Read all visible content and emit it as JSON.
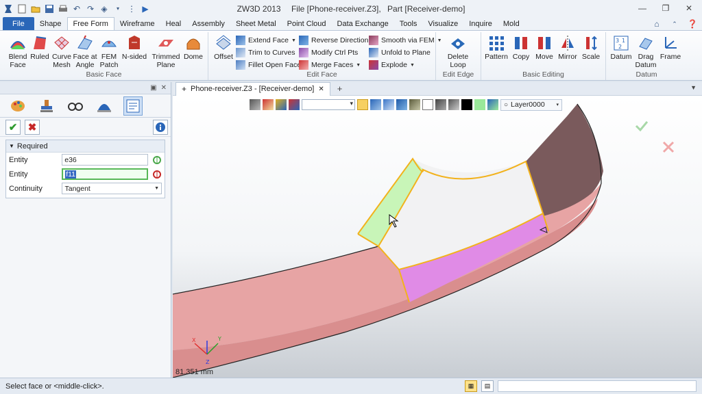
{
  "window": {
    "app_title": "ZW3D 2013",
    "file_title": "File [Phone-receiver.Z3],",
    "part_title": "Part [Receiver-demo]"
  },
  "tabs": [
    "File",
    "Shape",
    "Free Form",
    "Wireframe",
    "Heal",
    "Assembly",
    "Sheet Metal",
    "Point Cloud",
    "Data Exchange",
    "Tools",
    "Visualize",
    "Inquire",
    "Mold"
  ],
  "active_tab": "Free Form",
  "ribbon": {
    "basic_face": {
      "label": "Basic Face",
      "buttons": [
        {
          "l1": "Blend",
          "l2": "Face"
        },
        {
          "l1": "Ruled",
          "l2": ""
        },
        {
          "l1": "Curve",
          "l2": "Mesh"
        },
        {
          "l1": "Face at",
          "l2": "Angle"
        },
        {
          "l1": "FEM",
          "l2": "Patch"
        },
        {
          "l1": "N-sided",
          "l2": ""
        },
        {
          "l1": "Trimmed",
          "l2": "Plane"
        },
        {
          "l1": "Dome",
          "l2": ""
        }
      ]
    },
    "edit_face": {
      "label": "Edit Face",
      "offset": "Offset",
      "col1": [
        "Extend Face",
        "Trim to Curves",
        "Fillet Open Faces"
      ],
      "col2": [
        "Reverse Direction",
        "Modify Ctrl Pts",
        "Merge Faces"
      ],
      "col3": [
        "Smooth via FEM",
        "Unfold to Plane",
        "Explode"
      ]
    },
    "edit_edge": {
      "label": "Edit Edge",
      "btn_l1": "Delete",
      "btn_l2": "Loop"
    },
    "basic_editing": {
      "label": "Basic Editing",
      "buttons": [
        "Pattern",
        "Copy",
        "Move",
        "Mirror",
        "Scale"
      ]
    },
    "datum": {
      "label": "Datum",
      "buttons": [
        {
          "l1": "Datum",
          "l2": ""
        },
        {
          "l1": "Drag",
          "l2": "Datum"
        },
        {
          "l1": "Frame",
          "l2": ""
        }
      ]
    }
  },
  "panel": {
    "section": "Required",
    "fields": [
      {
        "label": "Entity",
        "value": "e36"
      },
      {
        "label": "Entity",
        "value": "f11"
      },
      {
        "label": "Continuity",
        "value": "Tangent"
      }
    ]
  },
  "document": {
    "tab_label": "Phone-receiver.Z3 - [Receiver-demo]",
    "layer": "Layer0000",
    "measure": "81.351 mm"
  },
  "status": {
    "message": "Select face or <middle-click>."
  },
  "colors": {
    "ribbon_file_tab": "#2a66b8",
    "surface_pink": "#e79a9a",
    "selected_face_green": "#c8f5b8",
    "selected_face_magenta": "#e08be6",
    "edge_highlight": "#f2b21c",
    "dark_band": "#7a5a5c"
  }
}
